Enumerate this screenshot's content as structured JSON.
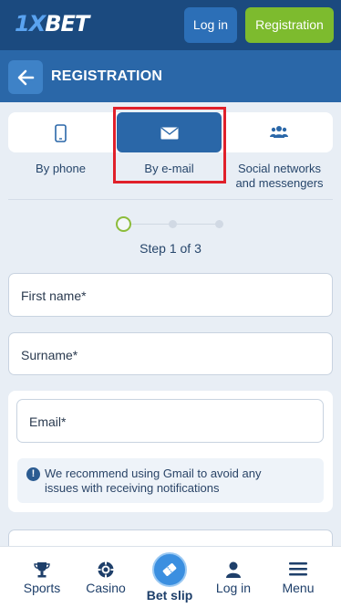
{
  "topbar": {
    "logo_prefix": "1X",
    "logo_suffix": "BET",
    "login_label": "Log in",
    "registration_label": "Registration"
  },
  "header": {
    "title": "REGISTRATION"
  },
  "tabs": [
    {
      "label": "By phone",
      "icon": "phone-icon"
    },
    {
      "label": "By e-mail",
      "icon": "envelope-icon"
    },
    {
      "label_line1": "Social networks",
      "label_line2": "and messengers",
      "icon": "users-icon"
    }
  ],
  "stepper": {
    "text": "Step 1 of 3",
    "current": 1,
    "total": 3
  },
  "form": {
    "first_name_placeholder": "First name*",
    "surname_placeholder": "Surname*",
    "email_placeholder": "Email*",
    "notice_line1": "We recommend using Gmail to avoid any",
    "notice_line2": "issues with receiving notifications"
  },
  "bottom_nav": [
    {
      "label": "Sports",
      "icon": "trophy-icon"
    },
    {
      "label": "Casino",
      "icon": "casino-chip-icon"
    },
    {
      "label": "Bet slip",
      "icon": "ticket-icon"
    },
    {
      "label": "Log in",
      "icon": "user-icon"
    },
    {
      "label": "Menu",
      "icon": "hamburger-icon"
    }
  ],
  "colors": {
    "topbar": "#1b4a7f",
    "header": "#2a67a8",
    "registration_button": "#7dbb2e",
    "active_tab": "#2a67a8",
    "highlight_box": "#e0202a",
    "step_active": "#8cbc3a"
  }
}
